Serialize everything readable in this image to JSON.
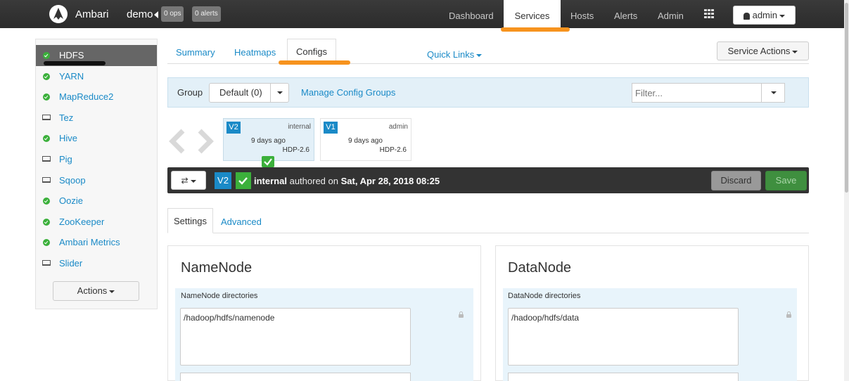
{
  "topbar": {
    "brand": "Ambari",
    "cluster": "demo",
    "ops_badge": "0 ops",
    "alerts_badge": "0 alerts",
    "nav": [
      "Dashboard",
      "Services",
      "Hosts",
      "Alerts",
      "Admin"
    ],
    "active_nav": "Services",
    "user_label": "admin"
  },
  "sidebar": {
    "services": [
      {
        "label": "HDFS",
        "status": "ok"
      },
      {
        "label": "YARN",
        "status": "ok"
      },
      {
        "label": "MapReduce2",
        "status": "ok"
      },
      {
        "label": "Tez",
        "status": "client"
      },
      {
        "label": "Hive",
        "status": "ok"
      },
      {
        "label": "Pig",
        "status": "client"
      },
      {
        "label": "Sqoop",
        "status": "client"
      },
      {
        "label": "Oozie",
        "status": "ok"
      },
      {
        "label": "ZooKeeper",
        "status": "ok"
      },
      {
        "label": "Ambari Metrics",
        "status": "ok"
      },
      {
        "label": "Slider",
        "status": "client"
      }
    ],
    "actions_label": "Actions"
  },
  "service_tabs": {
    "summary": "Summary",
    "heatmaps": "Heatmaps",
    "configs": "Configs",
    "quick_links": "Quick Links",
    "service_actions": "Service Actions"
  },
  "config_group": {
    "label": "Group",
    "value": "Default (0)",
    "manage_link": "Manage Config Groups",
    "filter_placeholder": "Filter..."
  },
  "versions": [
    {
      "badge": "V2",
      "author": "internal",
      "when": "9 days ago",
      "stack": "HDP-2.6",
      "current": true
    },
    {
      "badge": "V1",
      "author": "admin",
      "when": "9 days ago",
      "stack": "HDP-2.6",
      "current": false
    }
  ],
  "version_bar": {
    "badge": "V2",
    "author": "internal",
    "authored_text": "authored on",
    "date": "Sat, Apr 28, 2018 08:25",
    "discard_label": "Discard",
    "save_label": "Save"
  },
  "settings_tabs": {
    "settings": "Settings",
    "advanced": "Advanced"
  },
  "panels": {
    "namenode": {
      "title": "NameNode",
      "field_label": "NameNode directories",
      "value": "/hadoop/hdfs/namenode"
    },
    "datanode": {
      "title": "DataNode",
      "field_label": "DataNode directories",
      "value": "/hadoop/hdfs/data"
    }
  },
  "colors": {
    "accent": "#1a8ac7",
    "success": "#3bb03b",
    "highlight": "#f7931e",
    "topbar": "#2f2f2f"
  }
}
